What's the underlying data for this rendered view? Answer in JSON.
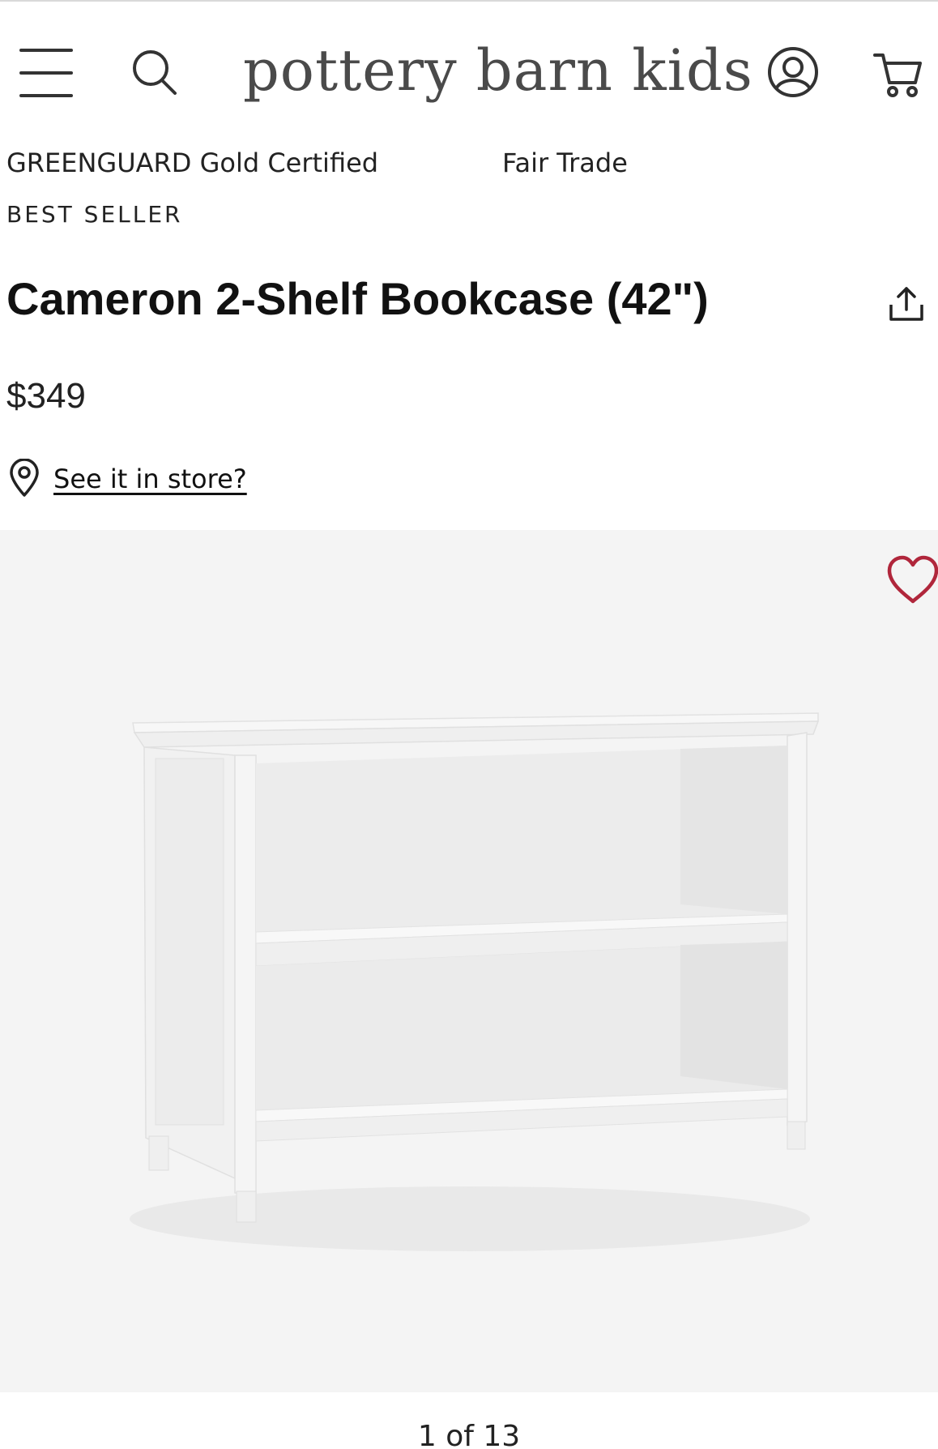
{
  "header": {
    "logo_text": "pottery barn kids",
    "menu_icon": "hamburger-menu-icon",
    "search_icon": "search-icon",
    "account_icon": "account-icon",
    "cart_icon": "cart-icon"
  },
  "badges": {
    "certification": "GREENGUARD Gold Certified",
    "fair_trade": "Fair Trade",
    "best_seller": "BEST SELLER"
  },
  "product": {
    "title": "Cameron 2-Shelf Bookcase (42\")",
    "price": "$349",
    "store_link": "See it in store?",
    "share_icon": "share-icon",
    "favorite_icon": "heart-icon",
    "image_position": "1 of 13"
  },
  "colors": {
    "favorite_heart": "#b0263b",
    "gallery_bg": "#f4f4f4",
    "logo_text": "#4a4a4a"
  }
}
